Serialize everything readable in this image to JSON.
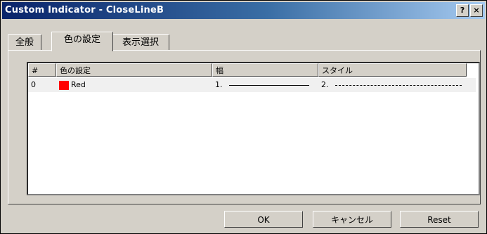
{
  "window": {
    "title": "Custom Indicator - CloseLineB",
    "help_label": "?",
    "close_label": "×"
  },
  "tabs": [
    {
      "label": "全般"
    },
    {
      "label": "色の設定"
    },
    {
      "label": "表示選択"
    }
  ],
  "table": {
    "columns": [
      "#",
      "色の設定",
      "幅",
      "スタイル"
    ],
    "rows": [
      {
        "index": "0",
        "color_name": "Red",
        "color_hex": "#ff0000",
        "width": "1.",
        "style": "2."
      }
    ]
  },
  "buttons": {
    "ok": "OK",
    "cancel": "キャンセル",
    "reset": "Reset"
  }
}
